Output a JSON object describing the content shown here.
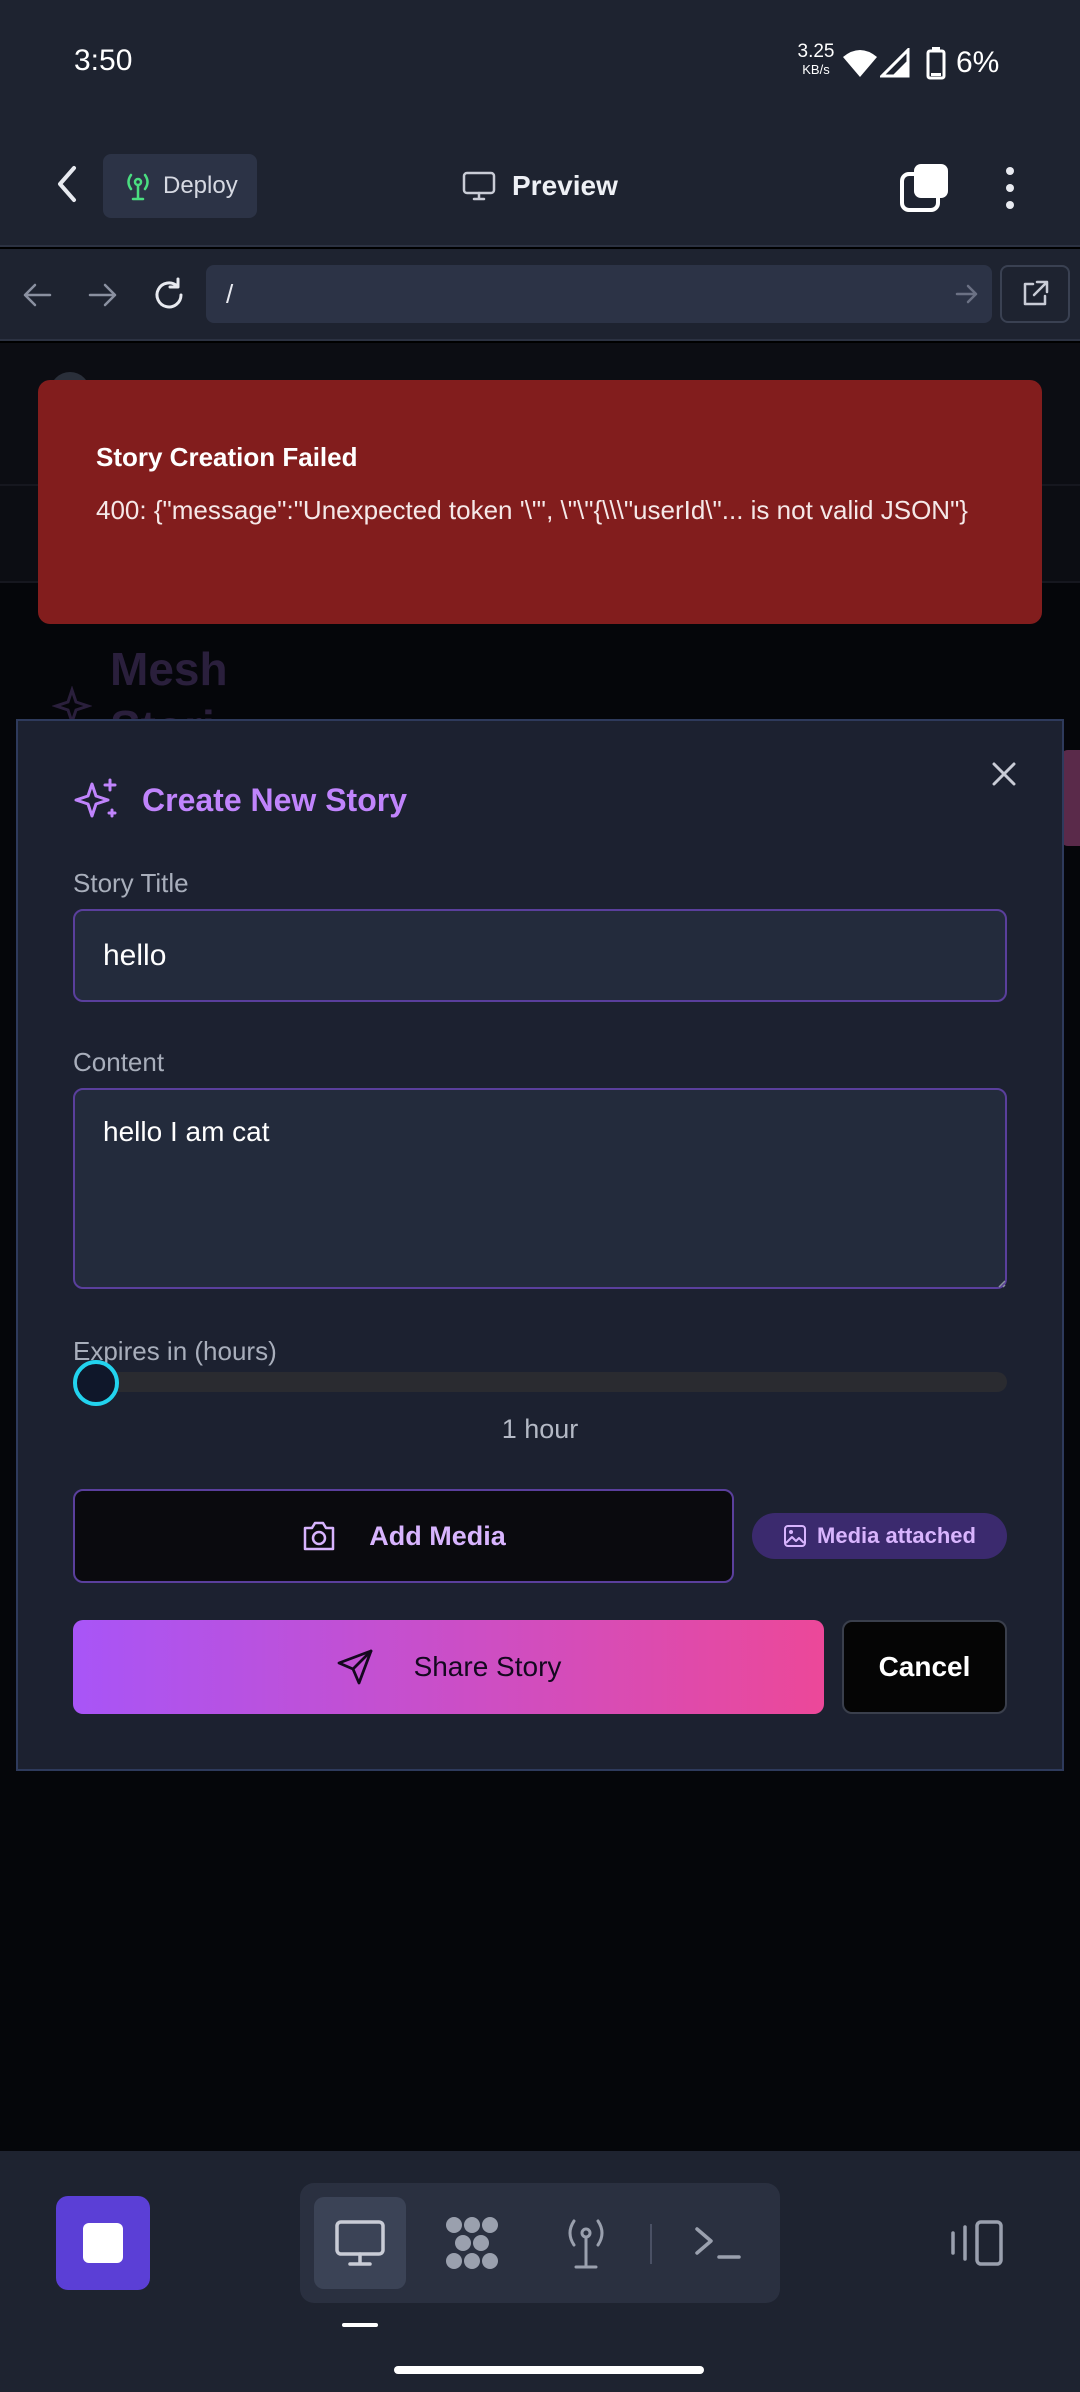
{
  "status_bar": {
    "time": "3:50",
    "net_speed_value": "3.25",
    "net_speed_unit": "KB/s",
    "battery": "6%"
  },
  "toolbar": {
    "deploy_label": "Deploy",
    "preview_label": "Preview"
  },
  "url_bar": {
    "value": "/"
  },
  "background_app": {
    "brand_line1": "Mesh",
    "brand_line2": "Stori"
  },
  "toast": {
    "title": "Story Creation Failed",
    "message": "400: {\"message\":\"Unexpected token '\\\"', \\\"\\\"{\\\\\\\"userId\\\"... is not valid JSON\"}"
  },
  "modal": {
    "title": "Create New Story",
    "story_title_label": "Story Title",
    "story_title_value": "hello",
    "content_label": "Content",
    "content_value": "hello I am cat",
    "expires_label": "Expires in (hours)",
    "expires_value": "1 hour",
    "expires_hours": 1,
    "add_media_label": "Add Media",
    "media_badge_label": "Media attached",
    "share_label": "Share Story",
    "cancel_label": "Cancel"
  },
  "colors": {
    "accent_purple": "#c084fc",
    "gradient_start": "#a855f7",
    "gradient_end": "#ec4899",
    "error_red": "#821d1d",
    "slider_thumb": "#22d3ee",
    "stop_button": "#5b3fd6"
  },
  "icons": {
    "deploy": "antenna-icon",
    "preview": "monitor-icon",
    "modal_title": "sparkles-icon",
    "add_media": "camera-icon",
    "media_badge": "image-icon",
    "share": "send-icon"
  }
}
